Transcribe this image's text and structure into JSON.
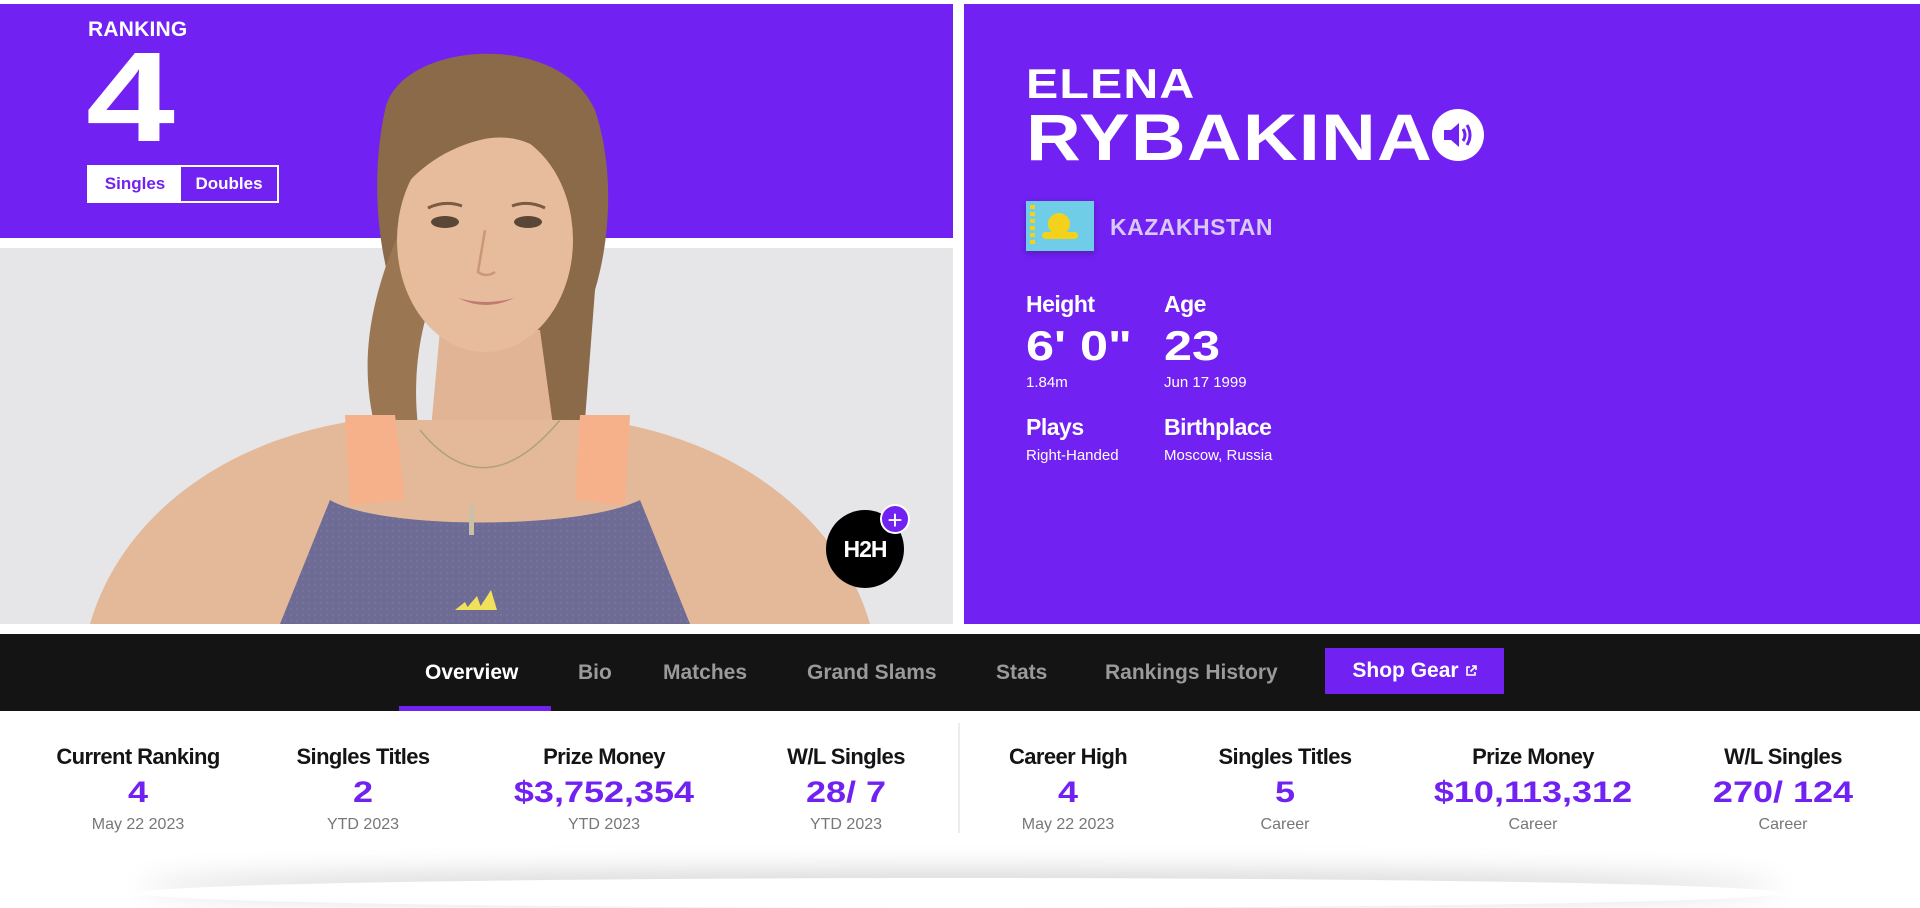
{
  "hero": {
    "ranking_label": "RANKING",
    "ranking_number": "4",
    "toggle": {
      "singles": "Singles",
      "doubles": "Doubles"
    },
    "h2h_label": "H2H",
    "h2h_plus": "+"
  },
  "player": {
    "first_name": "ELENA",
    "last_name": "RYBAKINA",
    "country": "KAZAKHSTAN",
    "height_label": "Height",
    "height_value": "6' 0\"",
    "height_metric": "1.84m",
    "age_label": "Age",
    "age_value": "23",
    "birthdate": "Jun 17 1999",
    "plays_label": "Plays",
    "plays_value": "Right-Handed",
    "birthplace_label": "Birthplace",
    "birthplace_value": "Moscow, Russia"
  },
  "nav": {
    "tabs": [
      "Overview",
      "Bio",
      "Matches",
      "Grand Slams",
      "Stats",
      "Rankings History"
    ],
    "active_tab": "Overview",
    "shop_label": "Shop Gear"
  },
  "stats": [
    {
      "label": "Current Ranking",
      "value": "4",
      "sub": "May 22 2023"
    },
    {
      "label": "Singles Titles",
      "value": "2",
      "sub": "YTD 2023"
    },
    {
      "label": "Prize Money",
      "value": "$3,752,354",
      "sub": "YTD 2023"
    },
    {
      "label": "W/L Singles",
      "value": "28/ 7",
      "sub": "YTD 2023"
    },
    {
      "label": "Career High",
      "value": "4",
      "sub": "May 22 2023"
    },
    {
      "label": "Singles Titles",
      "value": "5",
      "sub": "Career"
    },
    {
      "label": "Prize Money",
      "value": "$10,113,312",
      "sub": "Career"
    },
    {
      "label": "W/L Singles",
      "value": "270/ 124",
      "sub": "Career"
    }
  ],
  "colors": {
    "accent": "#7121f2",
    "nav_bg": "#141414",
    "flag_blue": "#6fcde8",
    "flag_gold": "#f4d21b"
  },
  "icons": [
    "speaker-icon",
    "external-link-icon",
    "kazakhstan-flag-icon",
    "plus-icon"
  ]
}
